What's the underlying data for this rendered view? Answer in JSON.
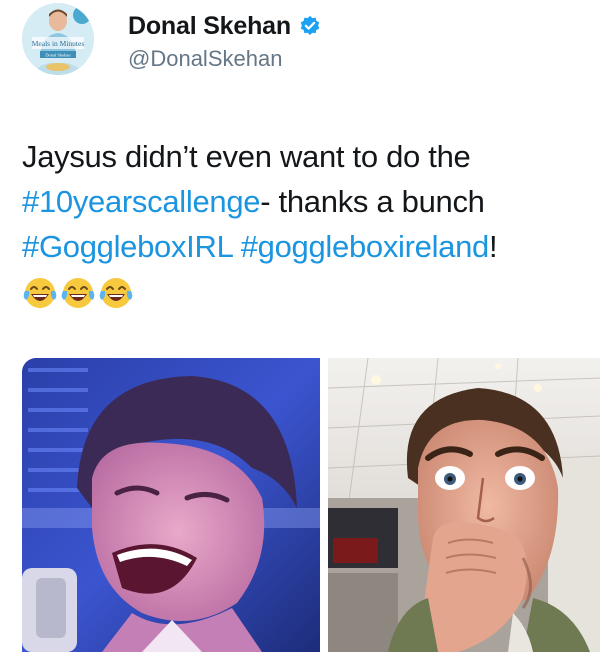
{
  "author": {
    "display_name": "Donal Skehan",
    "handle": "@DonalSkehan",
    "verified": true,
    "avatar_text": [
      "Meals in Minutes",
      "Donal Skehan"
    ],
    "avatar_icon": "profile-photo"
  },
  "tweet": {
    "line1": "Jaysus didn’t even want to do the",
    "hashtag1": "#10yearscallenge",
    "line2_rest": "- thanks a bunch",
    "hashtag2": "#GoggleboxIRL",
    "hashtag3": "#goggleboxireland",
    "line3_end": "!",
    "emojis": [
      "face-with-tears-of-joy",
      "face-with-tears-of-joy",
      "face-with-tears-of-joy"
    ]
  },
  "media": {
    "photos": [
      {
        "description_icon": "photo-young-man-laughing"
      },
      {
        "description_icon": "photo-man-selfie-surprised"
      }
    ]
  },
  "colors": {
    "link": "#1b95e0",
    "text": "#14171a",
    "secondary": "#657786",
    "verified": "#1da1f2"
  }
}
